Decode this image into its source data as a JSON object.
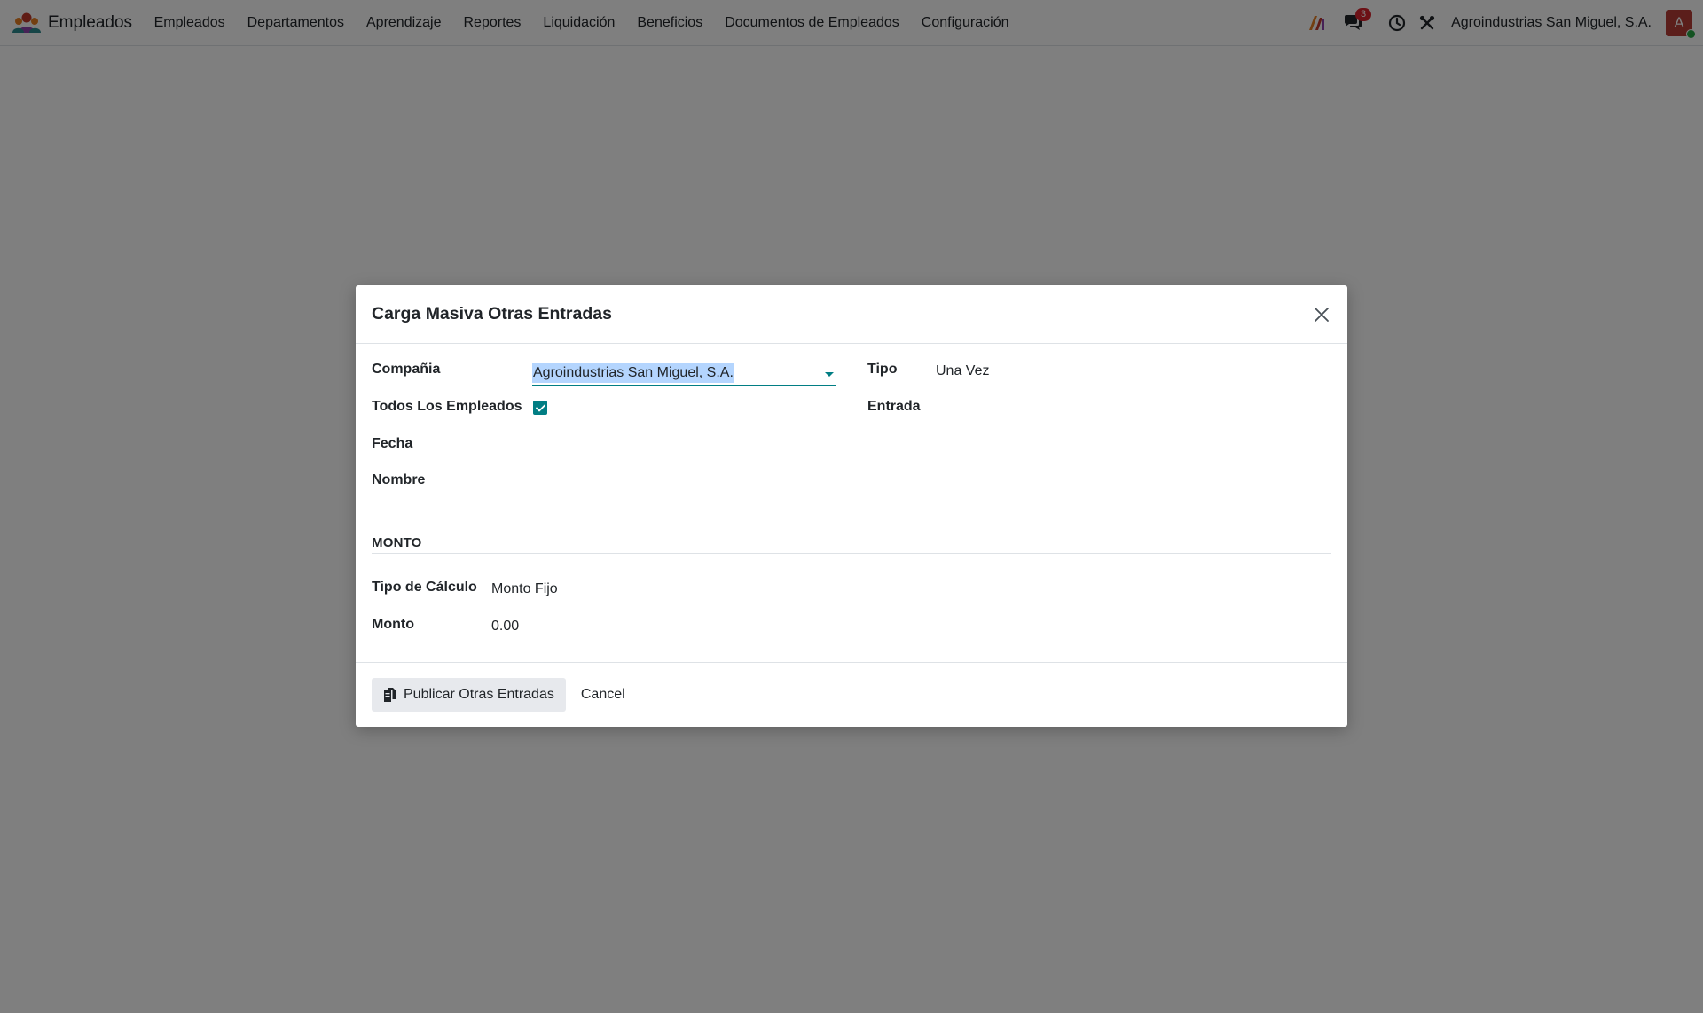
{
  "app": {
    "title": "Empleados",
    "icon": "employees-app-icon"
  },
  "menu": [
    {
      "label": "Empleados"
    },
    {
      "label": "Departamentos"
    },
    {
      "label": "Aprendizaje"
    },
    {
      "label": "Reportes"
    },
    {
      "label": "Liquidación"
    },
    {
      "label": "Beneficios"
    },
    {
      "label": "Documentos de Empleados"
    },
    {
      "label": "Configuración"
    }
  ],
  "systray": {
    "messages_count": "3",
    "company": "Agroindustrias San Miguel, S.A.",
    "avatar_letter": "A",
    "avatar_color": "#b63d37",
    "online_color": "#28a745"
  },
  "modal": {
    "title": "Carga Masiva Otras Entradas",
    "fields": {
      "compania_label": "Compañia",
      "compania_value": "Agroindustrias San Miguel, S.A.",
      "todos_label": "Todos Los Empleados",
      "todos_checked": true,
      "fecha_label": "Fecha",
      "nombre_label": "Nombre",
      "tipo_label": "Tipo",
      "tipo_value": "Una Vez",
      "entrada_label": "Entrada"
    },
    "section": {
      "title": "MONTO",
      "tipo_calculo_label": "Tipo de Cálculo",
      "tipo_calculo_value": "Monto Fijo",
      "monto_label": "Monto",
      "monto_value": "0.00"
    },
    "footer": {
      "publish_label": "Publicar Otras Entradas",
      "cancel_label": "Cancel"
    }
  },
  "colors": {
    "accent": "#017e84",
    "badge": "#d9232d",
    "selection": "#b4d5fe"
  }
}
